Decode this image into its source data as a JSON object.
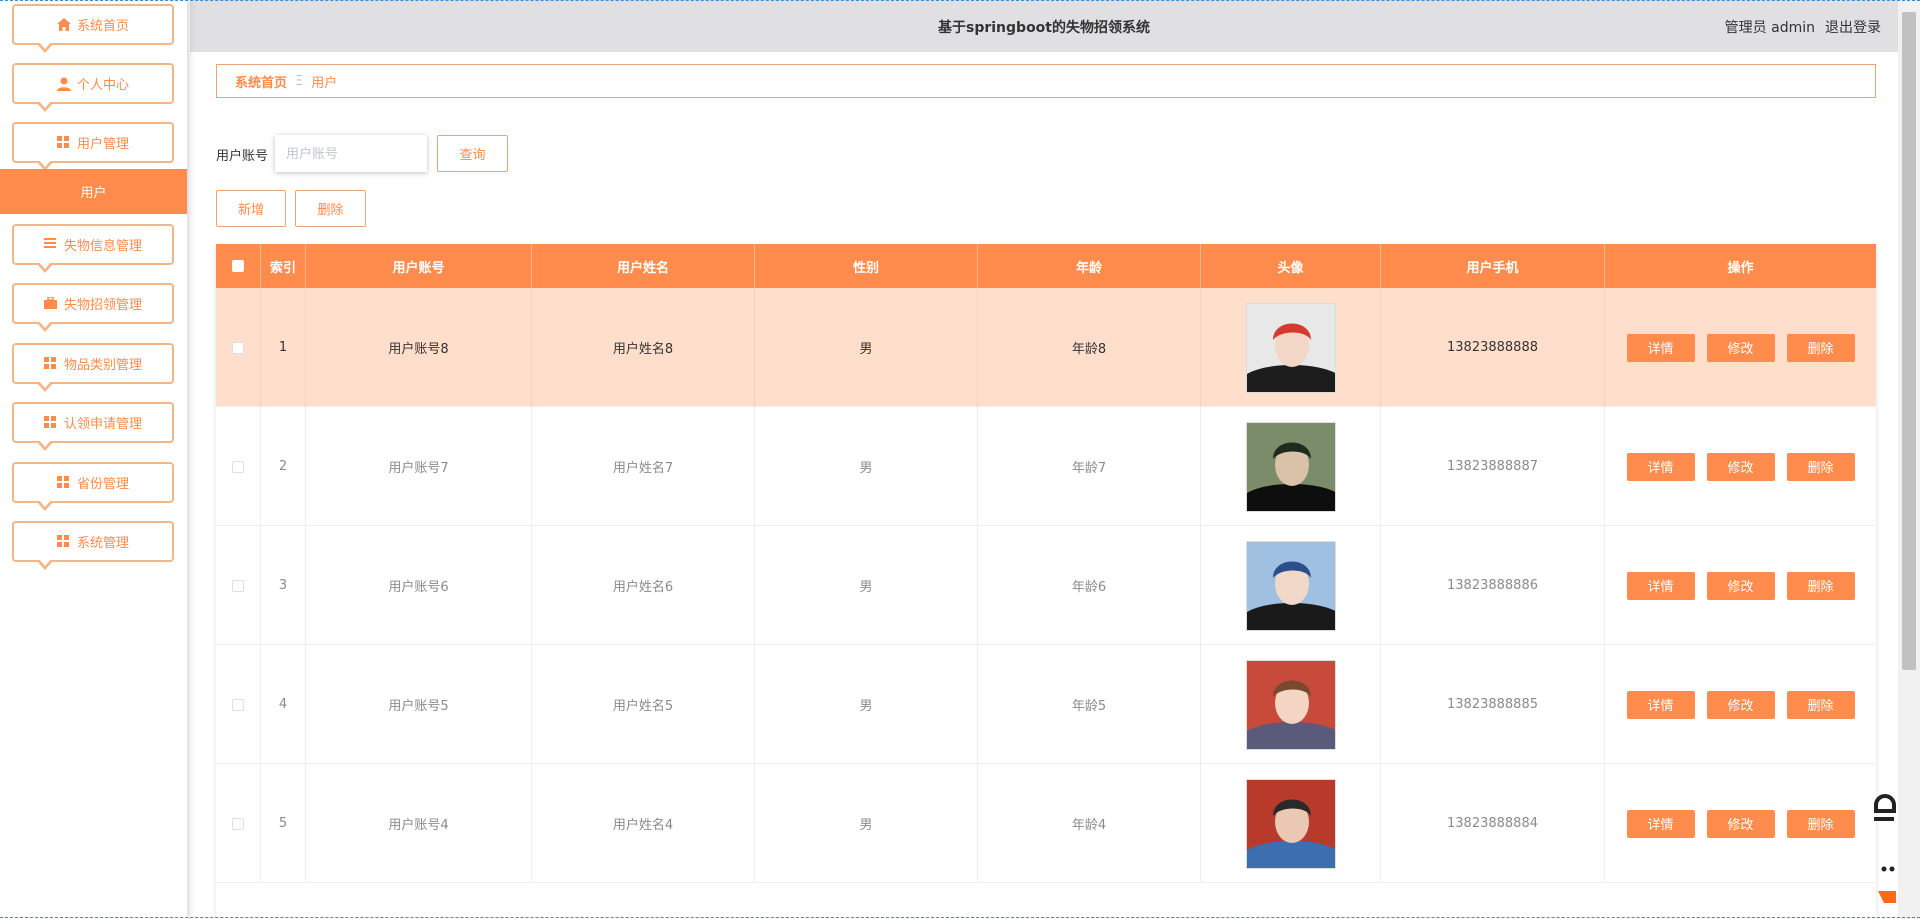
{
  "header": {
    "title": "基于springboot的失物招领系统",
    "role": "管理员",
    "username": "admin",
    "logout": "退出登录"
  },
  "sidebar": {
    "items": [
      {
        "label": "系统首页",
        "icon": "home-icon"
      },
      {
        "label": "个人中心",
        "icon": "user-icon"
      },
      {
        "label": "用户管理",
        "icon": "grid-icon"
      },
      {
        "label": "失物信息管理",
        "icon": "list-icon"
      },
      {
        "label": "失物招领管理",
        "icon": "briefcase-icon"
      },
      {
        "label": "物品类别管理",
        "icon": "grid-icon"
      },
      {
        "label": "认领申请管理",
        "icon": "grid-icon"
      },
      {
        "label": "省份管理",
        "icon": "grid-icon"
      },
      {
        "label": "系统管理",
        "icon": "grid-icon"
      }
    ],
    "active_sub": "用户"
  },
  "breadcrumb": {
    "home": "系统首页",
    "separator": "Ξ",
    "current": "用户"
  },
  "search": {
    "label": "用户账号",
    "placeholder": "用户账号",
    "button": "查询"
  },
  "actions": {
    "add": "新增",
    "delete": "删除"
  },
  "table": {
    "columns": [
      "索引",
      "用户账号",
      "用户姓名",
      "性别",
      "年龄",
      "头像",
      "用户手机",
      "操作"
    ],
    "rows": [
      {
        "index": "1",
        "account": "用户账号8",
        "name": "用户姓名8",
        "gender": "男",
        "age": "年龄8",
        "phone": "13823888888"
      },
      {
        "index": "2",
        "account": "用户账号7",
        "name": "用户姓名7",
        "gender": "男",
        "age": "年龄7",
        "phone": "13823888887"
      },
      {
        "index": "3",
        "account": "用户账号6",
        "name": "用户姓名6",
        "gender": "男",
        "age": "年龄6",
        "phone": "13823888886"
      },
      {
        "index": "4",
        "account": "用户账号5",
        "name": "用户姓名5",
        "gender": "男",
        "age": "年龄5",
        "phone": "13823888885"
      },
      {
        "index": "5",
        "account": "用户账号4",
        "name": "用户姓名4",
        "gender": "男",
        "age": "年龄4",
        "phone": "13823888884"
      }
    ],
    "row_actions": {
      "detail": "详情",
      "edit": "修改",
      "delete": "删除"
    }
  },
  "colors": {
    "accent": "#ff8c4d",
    "header_bg": "#e0dfe1",
    "highlight_row": "#ffdfcc",
    "border": "#e8a57c"
  }
}
